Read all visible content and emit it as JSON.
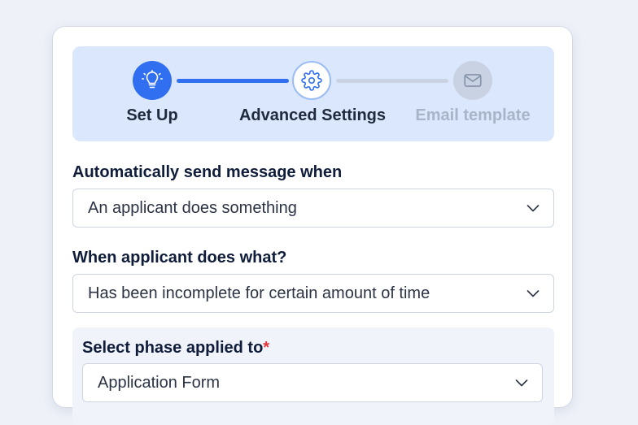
{
  "stepper": {
    "steps": [
      {
        "label": "Set Up",
        "icon": "lightbulb-icon",
        "state": "completed"
      },
      {
        "label": "Advanced Settings",
        "icon": "gear-icon",
        "state": "current"
      },
      {
        "label": "Email template",
        "icon": "envelope-icon",
        "state": "pending"
      }
    ]
  },
  "form": {
    "trigger_label": "Automatically send message when",
    "trigger_value": "An applicant does something",
    "action_label": "When applicant does what?",
    "action_value": "Has been incomplete for certain amount of time",
    "phase_label": "Select phase applied to",
    "phase_required_mark": "*",
    "phase_value": "Application Form"
  },
  "colors": {
    "accent": "#2f6ff0",
    "stepper_bg": "#dbe7fd",
    "required": "#e0333a",
    "page_bg": "#eef1f8"
  }
}
